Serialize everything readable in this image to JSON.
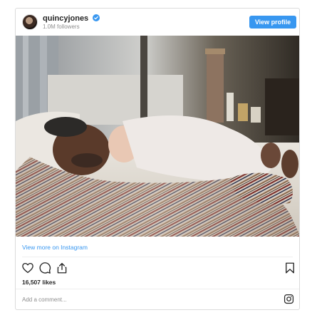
{
  "post": {
    "username": "quincyjones",
    "followers": "1.0M followers",
    "view_profile_label": "View profile",
    "photo_alt": "man sleeping with baby on chest",
    "view_more_label": "View more on Instagram",
    "likes": "16,507 likes",
    "comment_placeholder": "Add a comment..."
  },
  "icons": {
    "verified": "verified-badge-icon",
    "like": "heart-icon",
    "comment": "comment-bubble-icon",
    "share": "share-icon",
    "save": "bookmark-icon",
    "instagram": "instagram-logo-icon"
  },
  "colors": {
    "accent": "#3897f0",
    "text": "#262626",
    "muted": "#8e8e8e",
    "border": "#dbdbdb"
  }
}
